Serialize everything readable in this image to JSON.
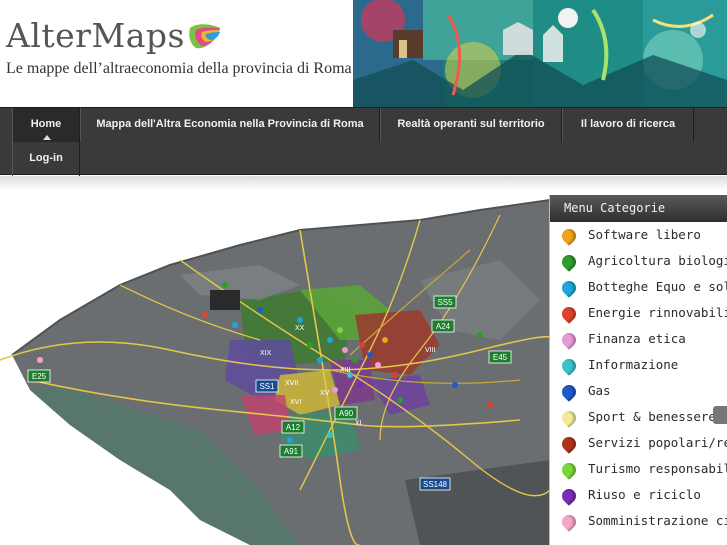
{
  "site": {
    "title": "AlterMaps",
    "tagline": "Le mappe dell’altraeconomia della provincia di Roma"
  },
  "nav": {
    "items": [
      {
        "label": "Home"
      },
      {
        "label": "Mappa dell'Altra Economia nella Provincia di Roma"
      },
      {
        "label": "Realtà operanti sul territorio"
      },
      {
        "label": "Il lavoro di ricerca"
      },
      {
        "label": "Log-in"
      }
    ]
  },
  "map": {
    "road_labels": [
      "SS5",
      "A24",
      "E45",
      "E25",
      "SS1",
      "A90",
      "A12",
      "A91",
      "SS148"
    ],
    "district_labels": [
      "XX",
      "XIX",
      "XVII",
      "XVI",
      "XV",
      "XIII",
      "VIII",
      "XI"
    ]
  },
  "category_menu": {
    "title": "Menu Categorie",
    "items": [
      {
        "label": "Software libero",
        "color": "#f2a11c"
      },
      {
        "label": "Agricoltura biologic",
        "color": "#2e9b2a"
      },
      {
        "label": "Botteghe Equo e sol",
        "color": "#1ea6d8"
      },
      {
        "label": "Energie rinnovabili",
        "color": "#e0412d"
      },
      {
        "label": "Finanza etica",
        "color": "#e79ad6"
      },
      {
        "label": "Informazione",
        "color": "#39c3c9"
      },
      {
        "label": "Gas",
        "color": "#1c5bc9"
      },
      {
        "label": "Sport & benessere",
        "color": "#f3eb9a"
      },
      {
        "label": "Servizi popolari/rea",
        "color": "#b1321c"
      },
      {
        "label": "Turismo responsabil",
        "color": "#7ad83a"
      },
      {
        "label": "Riuso e riciclo",
        "color": "#7a2cb3"
      },
      {
        "label": "Somministrazione ci",
        "color": "#f4a6c8"
      }
    ]
  }
}
